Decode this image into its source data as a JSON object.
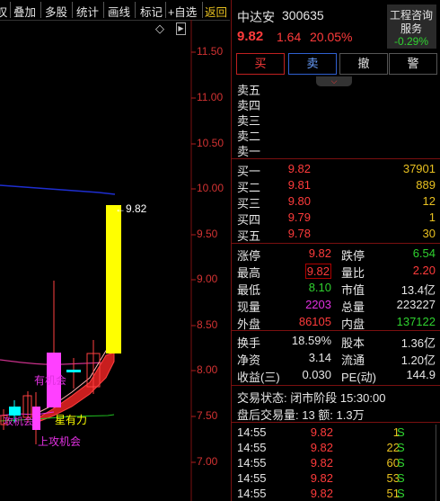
{
  "toolbar": {
    "items": [
      "叹",
      "叠加",
      "多股",
      "统计",
      "画线",
      "标记",
      "+自选",
      "返回"
    ]
  },
  "chart": {
    "y_ticks": [
      "11.50",
      "11.00",
      "10.50",
      "10.00",
      "9.50",
      "9.00",
      "8.50",
      "8.00",
      "7.50",
      "7.00"
    ],
    "price_tag": "9.82",
    "annotations": {
      "a1": "有机会",
      "a2": "星有力",
      "a3": "上攻机会",
      "a4": "攻机会"
    },
    "diamond": "◇",
    "arrow": "▶",
    "colors": {
      "up": "#ffff00",
      "down": "#00ffff",
      "ma_blue": "#1e2ed0",
      "ma_pink": "#e03a8a",
      "ma_green": "#20c020",
      "red_band": "#c81e1e"
    }
  },
  "stock": {
    "name": "中达安",
    "code": "300635",
    "price": "9.82",
    "change": "1.64",
    "pct": "20.05%",
    "industry": "工程咨询",
    "industry2": "服务",
    "industry_pct": "-0.29%"
  },
  "buttons": {
    "buy": "买",
    "sell": "卖",
    "cancel": "撤",
    "alert": "警"
  },
  "sell_levels": [
    "卖五",
    "卖四",
    "卖三",
    "卖二",
    "卖一"
  ],
  "buy_levels": [
    {
      "label": "买一",
      "price": "9.82",
      "qty": "37901"
    },
    {
      "label": "买二",
      "price": "9.81",
      "qty": "889"
    },
    {
      "label": "买三",
      "price": "9.80",
      "qty": "12"
    },
    {
      "label": "买四",
      "price": "9.79",
      "qty": "1"
    },
    {
      "label": "买五",
      "price": "9.78",
      "qty": "30"
    }
  ],
  "stats": [
    {
      "l1": "涨停",
      "v1": "9.82",
      "c1": "red",
      "l2": "跌停",
      "v2": "6.54",
      "c2": "green"
    },
    {
      "l1": "最高",
      "v1": "9.82",
      "c1": "red",
      "l2": "量比",
      "v2": "2.20",
      "c2": "red"
    },
    {
      "l1": "最低",
      "v1": "8.10",
      "c1": "green",
      "l2": "市值",
      "v2": "13.4亿",
      "c2": "wht"
    },
    {
      "l1": "现量",
      "v1": "2203",
      "c1": "mag",
      "l2": "总量",
      "v2": "223227",
      "c2": "wht"
    },
    {
      "l1": "外盘",
      "v1": "86105",
      "c1": "red",
      "l2": "内盘",
      "v2": "137122",
      "c2": "green"
    }
  ],
  "stats2": [
    {
      "l1": "换手",
      "v1": "18.59%",
      "l2": "股本",
      "v2": "1.36亿"
    },
    {
      "l1": "净资",
      "v1": "3.14",
      "l2": "流通",
      "v2": "1.20亿"
    },
    {
      "l1": "收益(三)",
      "v1": "0.030",
      "l2": "PE(动)",
      "v2": "144.9"
    }
  ],
  "status": {
    "line1": "交易状态: 闭市阶段 15:30:00",
    "line2": "盘后交易量: 13  额: 1.3万"
  },
  "ticks": [
    {
      "time": "14:55",
      "price": "9.82",
      "vol": "1",
      "side": "S"
    },
    {
      "time": "14:55",
      "price": "9.82",
      "vol": "22",
      "side": "S"
    },
    {
      "time": "14:55",
      "price": "9.82",
      "vol": "60",
      "side": "S"
    },
    {
      "time": "14:55",
      "price": "9.82",
      "vol": "53",
      "side": "S"
    },
    {
      "time": "14:55",
      "price": "9.82",
      "vol": "51",
      "side": "S"
    }
  ]
}
